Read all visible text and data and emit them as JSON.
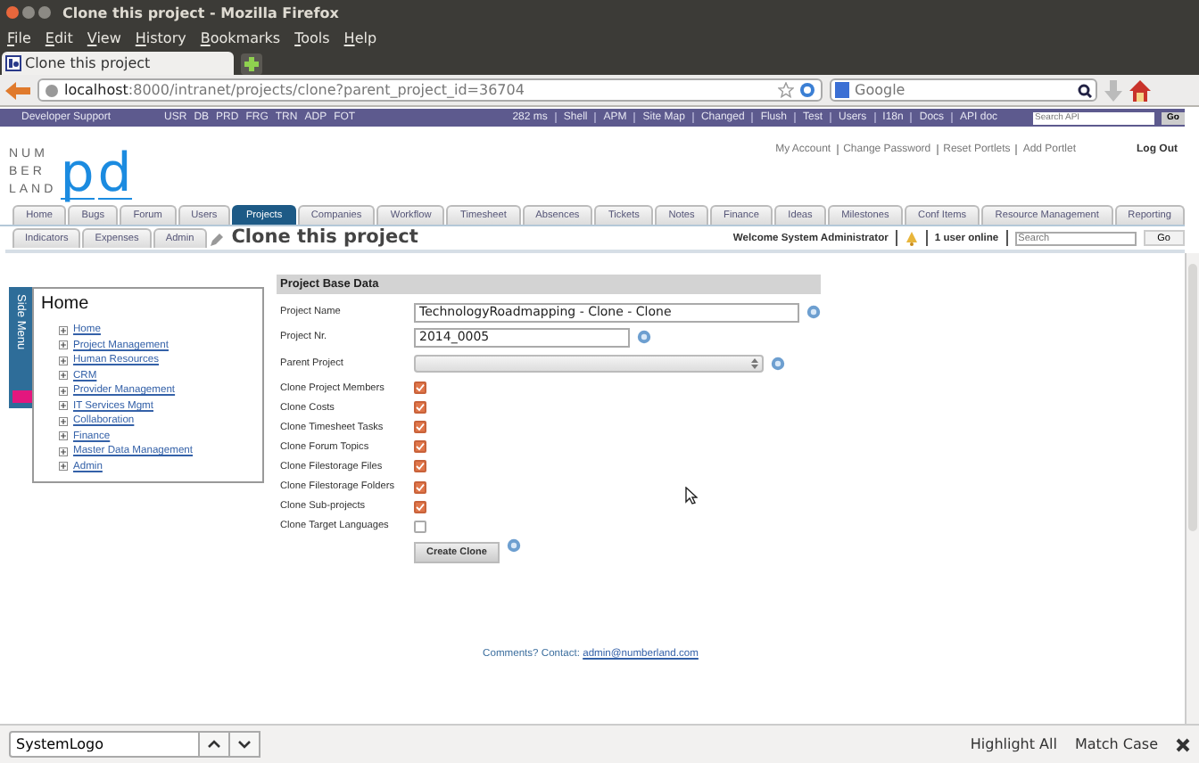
{
  "window": {
    "title": "Clone this project - Mozilla Firefox"
  },
  "menu": [
    "File",
    "Edit",
    "View",
    "History",
    "Bookmarks",
    "Tools",
    "Help"
  ],
  "browser_tabs": [
    {
      "label": "Clone this project",
      "selected": true
    }
  ],
  "address_bar": {
    "host": "localhost",
    "path": ":8000/intranet/projects/clone?parent_project_id=36704"
  },
  "web_search": {
    "placeholder": "Google"
  },
  "dev_bar": {
    "title": "Developer Support",
    "codes": [
      "USR",
      "DB",
      "PRD",
      "FRG",
      "TRN",
      "ADP",
      "FOT"
    ],
    "timing": "282 ms",
    "links": [
      "Shell",
      "APM",
      "Site Map",
      "Changed",
      "Flush",
      "Test",
      "Users",
      "I18n",
      "Docs",
      "API doc"
    ],
    "search": {
      "placeholder": "Search API"
    },
    "go": "Go"
  },
  "logo": {
    "lines": [
      "NUM",
      "BER",
      "LAND"
    ],
    "letters": [
      "p",
      "d"
    ]
  },
  "account_links": [
    "My Account",
    "Change Password",
    "Reset Portlets",
    "Add Portlet"
  ],
  "logout": "Log Out",
  "tab_rows": [
    {
      "tabs": [
        {
          "label": "Home",
          "selected": false
        },
        {
          "label": "Bugs",
          "selected": false
        },
        {
          "label": "Forum",
          "selected": false
        },
        {
          "label": "Users",
          "selected": false
        },
        {
          "label": "Projects",
          "selected": true
        },
        {
          "label": "Companies",
          "selected": false
        },
        {
          "label": "Workflow",
          "selected": false
        },
        {
          "label": "Timesheet",
          "selected": false
        },
        {
          "label": "Absences",
          "selected": false
        },
        {
          "label": "Tickets",
          "selected": false
        },
        {
          "label": "Notes",
          "selected": false
        },
        {
          "label": "Finance",
          "selected": false
        },
        {
          "label": "Ideas",
          "selected": false
        },
        {
          "label": "Milestones",
          "selected": false
        },
        {
          "label": "Conf Items",
          "selected": false
        },
        {
          "label": "Resource Management",
          "selected": false
        },
        {
          "label": "Reporting",
          "selected": false
        }
      ]
    },
    {
      "tabs": [
        {
          "label": "Indicators",
          "selected": false
        },
        {
          "label": "Expenses",
          "selected": false
        },
        {
          "label": "Admin",
          "selected": false
        }
      ]
    }
  ],
  "page_title": "Clone this project",
  "welcome": "Welcome System Administrator",
  "users_online": "1 user online",
  "site_search": {
    "placeholder": "Search",
    "go": "Go"
  },
  "side_menu": {
    "tab_label": "Side Menu",
    "title": "Home",
    "items": [
      "Home",
      "Project Management",
      "Human Resources",
      "CRM",
      "Provider Management",
      "IT Services Mgmt",
      "Collaboration",
      "Finance",
      "Master Data Management",
      "Admin"
    ]
  },
  "form": {
    "section": "Project Base Data",
    "fields": [
      {
        "kind": "text",
        "label": "Project Name",
        "value": "TechnologyRoadmapping - Clone - Clone"
      },
      {
        "kind": "text",
        "label": "Project Nr.",
        "value": "2014_0005"
      },
      {
        "kind": "select",
        "label": "Parent Project"
      }
    ],
    "options": [
      {
        "label": "Clone Project Members",
        "checked": true
      },
      {
        "label": "Clone Costs",
        "checked": true
      },
      {
        "label": "Clone Timesheet Tasks",
        "checked": true
      },
      {
        "label": "Clone Forum Topics",
        "checked": true
      },
      {
        "label": "Clone Filestorage Files",
        "checked": true
      },
      {
        "label": "Clone Filestorage Folders",
        "checked": true
      },
      {
        "label": "Clone Sub-projects",
        "checked": true
      },
      {
        "label": "Clone Target Languages",
        "checked": false
      }
    ],
    "submit": "Create Clone"
  },
  "footer": {
    "text": "Comments? Contact:",
    "email": "admin@numberland.com"
  },
  "find_bar": {
    "value": "SystemLogo",
    "highlight_all": "Highlight All",
    "match_case": "Match Case"
  }
}
